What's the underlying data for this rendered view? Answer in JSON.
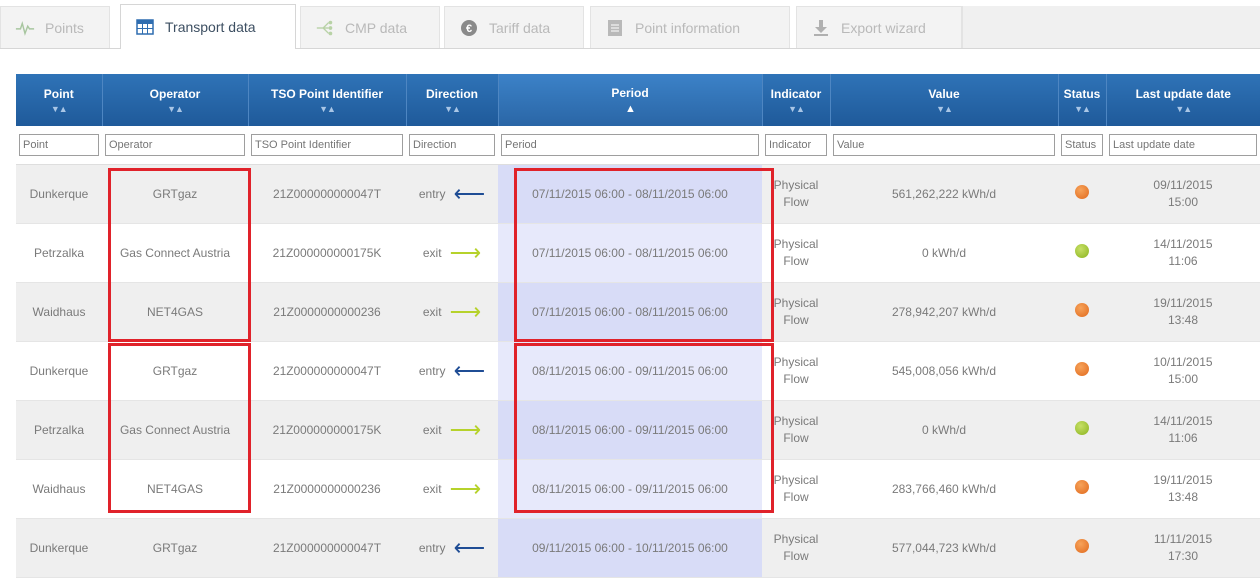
{
  "tabs": [
    {
      "label": "Points",
      "icon": "pulse-icon",
      "active": false
    },
    {
      "label": "Transport data",
      "icon": "table-icon",
      "active": true
    },
    {
      "label": "CMP data",
      "icon": "share-icon",
      "active": false
    },
    {
      "label": "Tariff data",
      "icon": "euro-icon",
      "active": false
    },
    {
      "label": "Point information",
      "icon": "document-icon",
      "active": false
    },
    {
      "label": "Export wizard",
      "icon": "download-icon",
      "active": false
    }
  ],
  "columns": [
    "Point",
    "Operator",
    "TSO Point Identifier",
    "Direction",
    "Period",
    "Indicator",
    "Value",
    "Status",
    "Last update date"
  ],
  "filters": [
    "Point",
    "Operator",
    "TSO Point Identifier",
    "Direction",
    "Period",
    "Indicator",
    "Value",
    "Status",
    "Last update date"
  ],
  "sort_column": "Period",
  "colors": {
    "header": "#1f5a9a",
    "highlight": "#e0222a",
    "status_orange": "#e0691d",
    "status_green": "#8ab31e",
    "entry_arrow": "#1f4d95",
    "exit_arrow": "#b6d22b"
  },
  "rows": [
    {
      "point": "Dunkerque",
      "operator": "GRTgaz",
      "tso": "21Z000000000047T",
      "direction": "entry",
      "period": "07/11/2015 06:00 - 08/11/2015 06:00",
      "indicator": "Physical Flow",
      "value": "561,262,222 kWh/d",
      "status": "orange",
      "updated_date": "09/11/2015",
      "updated_time": "15:00"
    },
    {
      "point": "Petrzalka",
      "operator": "Gas Connect Austria",
      "tso": "21Z000000000175K",
      "direction": "exit",
      "period": "07/11/2015 06:00 - 08/11/2015 06:00",
      "indicator": "Physical Flow",
      "value": "0 kWh/d",
      "status": "green",
      "updated_date": "14/11/2015",
      "updated_time": "11:06"
    },
    {
      "point": "Waidhaus",
      "operator": "NET4GAS",
      "tso": "21Z0000000000236",
      "direction": "exit",
      "period": "07/11/2015 06:00 - 08/11/2015 06:00",
      "indicator": "Physical Flow",
      "value": "278,942,207 kWh/d",
      "status": "orange",
      "updated_date": "19/11/2015",
      "updated_time": "13:48"
    },
    {
      "point": "Dunkerque",
      "operator": "GRTgaz",
      "tso": "21Z000000000047T",
      "direction": "entry",
      "period": "08/11/2015 06:00 - 09/11/2015 06:00",
      "indicator": "Physical Flow",
      "value": "545,008,056 kWh/d",
      "status": "orange",
      "updated_date": "10/11/2015",
      "updated_time": "15:00"
    },
    {
      "point": "Petrzalka",
      "operator": "Gas Connect Austria",
      "tso": "21Z000000000175K",
      "direction": "exit",
      "period": "08/11/2015 06:00 - 09/11/2015 06:00",
      "indicator": "Physical Flow",
      "value": "0 kWh/d",
      "status": "green",
      "updated_date": "14/11/2015",
      "updated_time": "11:06"
    },
    {
      "point": "Waidhaus",
      "operator": "NET4GAS",
      "tso": "21Z0000000000236",
      "direction": "exit",
      "period": "08/11/2015 06:00 - 09/11/2015 06:00",
      "indicator": "Physical Flow",
      "value": "283,766,460 kWh/d",
      "status": "orange",
      "updated_date": "19/11/2015",
      "updated_time": "13:48"
    },
    {
      "point": "Dunkerque",
      "operator": "GRTgaz",
      "tso": "21Z000000000047T",
      "direction": "entry",
      "period": "09/11/2015 06:00 - 10/11/2015 06:00",
      "indicator": "Physical Flow",
      "value": "577,044,723 kWh/d",
      "status": "orange",
      "updated_date": "11/11/2015",
      "updated_time": "17:30"
    }
  ]
}
